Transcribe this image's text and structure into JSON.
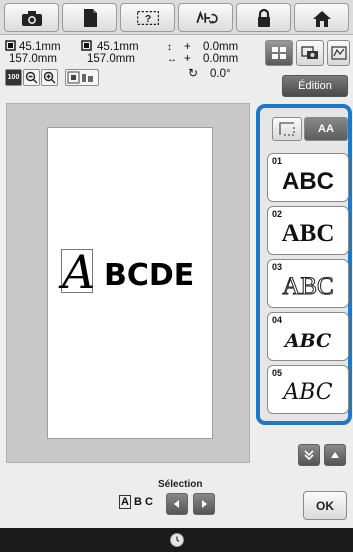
{
  "toolbar": {
    "buttons": [
      {
        "name": "camera-icon"
      },
      {
        "name": "document-icon"
      },
      {
        "name": "help-icon",
        "label": "?"
      },
      {
        "name": "stitch-settings-icon"
      },
      {
        "name": "lock-icon"
      },
      {
        "name": "home-icon"
      }
    ]
  },
  "info": {
    "width_mm": "45.1mm",
    "height_mm": "157.0mm",
    "width2_mm": "45.1mm",
    "height2_mm": "157.0mm",
    "offset_v": "0.0mm",
    "offset_h": "0.0mm",
    "rotation": "0.0°",
    "plus": "+",
    "zoom_label": "100"
  },
  "edition_label": "Édition",
  "canvas": {
    "text_first": "A",
    "text_rest": "BCDE"
  },
  "size_toggle": {
    "label": "AA"
  },
  "fonts": [
    {
      "num": "01",
      "sample": "ABC"
    },
    {
      "num": "02",
      "sample": "ABC"
    },
    {
      "num": "03",
      "sample": "ABC"
    },
    {
      "num": "04",
      "sample": "ABC"
    },
    {
      "num": "05",
      "sample": "ABC"
    }
  ],
  "selection": {
    "label": "Sélection",
    "preview": "ABC"
  },
  "ok_label": "OK",
  "colors": {
    "accent": "#1e78c8",
    "dark": "#1a1a1a"
  }
}
